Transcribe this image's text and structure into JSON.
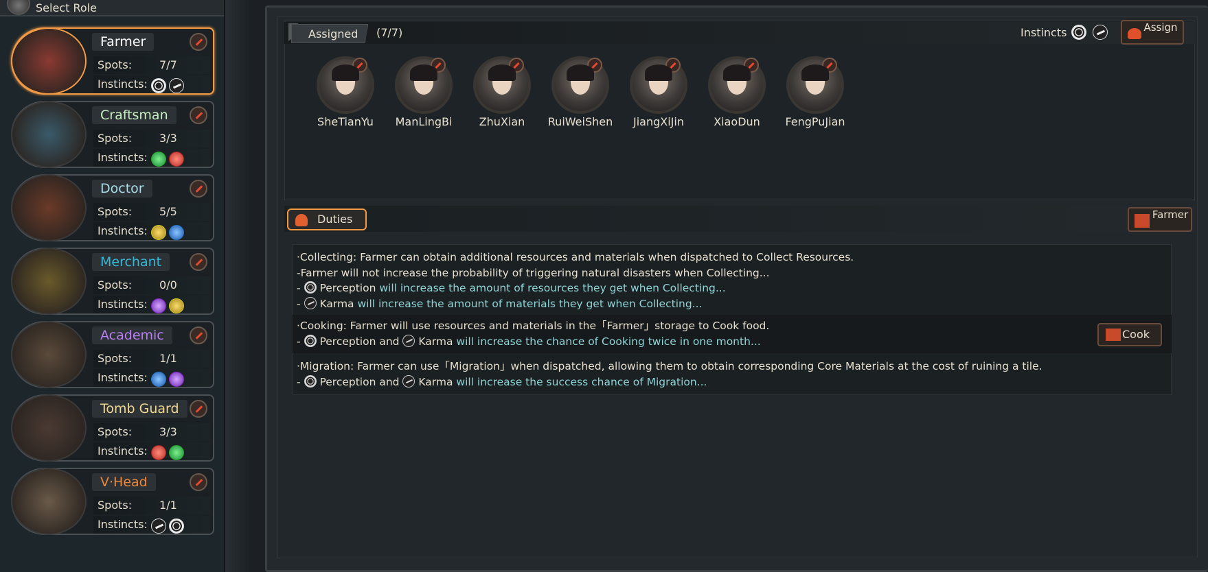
{
  "header": {
    "select_role_label": "Select Role"
  },
  "roles": [
    {
      "name": "Farmer",
      "name_color": "#ffffff",
      "spots_label": "Spots:",
      "spots": "7/7",
      "instincts_label": "Instincts:",
      "instincts": [
        "perception",
        "karma"
      ],
      "selected": true
    },
    {
      "name": "Craftsman",
      "name_color": "#c8f0c0",
      "spots_label": "Spots:",
      "spots": "3/3",
      "instincts_label": "Instincts:",
      "instincts": [
        "green",
        "red"
      ],
      "selected": false
    },
    {
      "name": "Doctor",
      "name_color": "#a8dce8",
      "spots_label": "Spots:",
      "spots": "5/5",
      "instincts_label": "Instincts:",
      "instincts": [
        "yellow",
        "blue"
      ],
      "selected": false
    },
    {
      "name": "Merchant",
      "name_color": "#38b8d8",
      "spots_label": "Spots:",
      "spots": "0/0",
      "instincts_label": "Instincts:",
      "instincts": [
        "purple",
        "yellow"
      ],
      "selected": false
    },
    {
      "name": "Academic",
      "name_color": "#b880f0",
      "spots_label": "Spots:",
      "spots": "1/1",
      "instincts_label": "Instincts:",
      "instincts": [
        "blue",
        "purple"
      ],
      "selected": false
    },
    {
      "name": "Tomb Guard",
      "name_color": "#f0d890",
      "spots_label": "Spots:",
      "spots": "3/3",
      "instincts_label": "Instincts:",
      "instincts": [
        "red",
        "green"
      ],
      "selected": false
    },
    {
      "name": "V·Head",
      "name_color": "#f08838",
      "spots_label": "Spots:",
      "spots": "1/1",
      "instincts_label": "Instincts:",
      "instincts": [
        "karma",
        "perception"
      ],
      "selected": false
    }
  ],
  "assigned": {
    "tag": "Assigned",
    "count": "(7/7)",
    "instincts_label": "Instincts",
    "assign_button": "Assign",
    "characters": [
      "SheTianYu",
      "ManLingBi",
      "ZhuXian",
      "RuiWeiShen",
      "JiangXiJin",
      "XiaoDun",
      "FengPuJian"
    ]
  },
  "duties": {
    "tab_label": "Duties",
    "farmer_button": "Farmer",
    "cook_button": "Cook",
    "collecting": {
      "line1": "·Collecting: Farmer can obtain additional resources and materials when dispatched to Collect Resources.",
      "line2": "-Farmer will not increase the probability of triggering natural disasters when Collecting...",
      "line3_prefix": "- ",
      "line3_instinct": "Perception",
      "line3_text": " will increase the amount of resources they get when Collecting...",
      "line4_prefix": "- ",
      "line4_instinct": "Karma",
      "line4_text": " will increase the amount of materials they get when Collecting..."
    },
    "cooking": {
      "line1": "·Cooking: Farmer will use resources and materials in the「Farmer」storage to Cook food.",
      "line2_prefix": "- ",
      "line2_instinct_a": "Perception and ",
      "line2_instinct_b": "Karma",
      "line2_text": " will increase the chance of Cooking twice in one month..."
    },
    "migration": {
      "line1": "·Migration: Farmer can use「Migration」when dispatched, allowing them to obtain corresponding Core Materials at the cost of ruining a tile.",
      "line2_prefix": "- ",
      "line2_instinct_a": "Perception and ",
      "line2_instinct_b": "Karma",
      "line2_text": " will increase the success chance of Migration..."
    }
  },
  "colors": {
    "accent": "#f09a46",
    "highlight_text": "#8fd4d6"
  }
}
